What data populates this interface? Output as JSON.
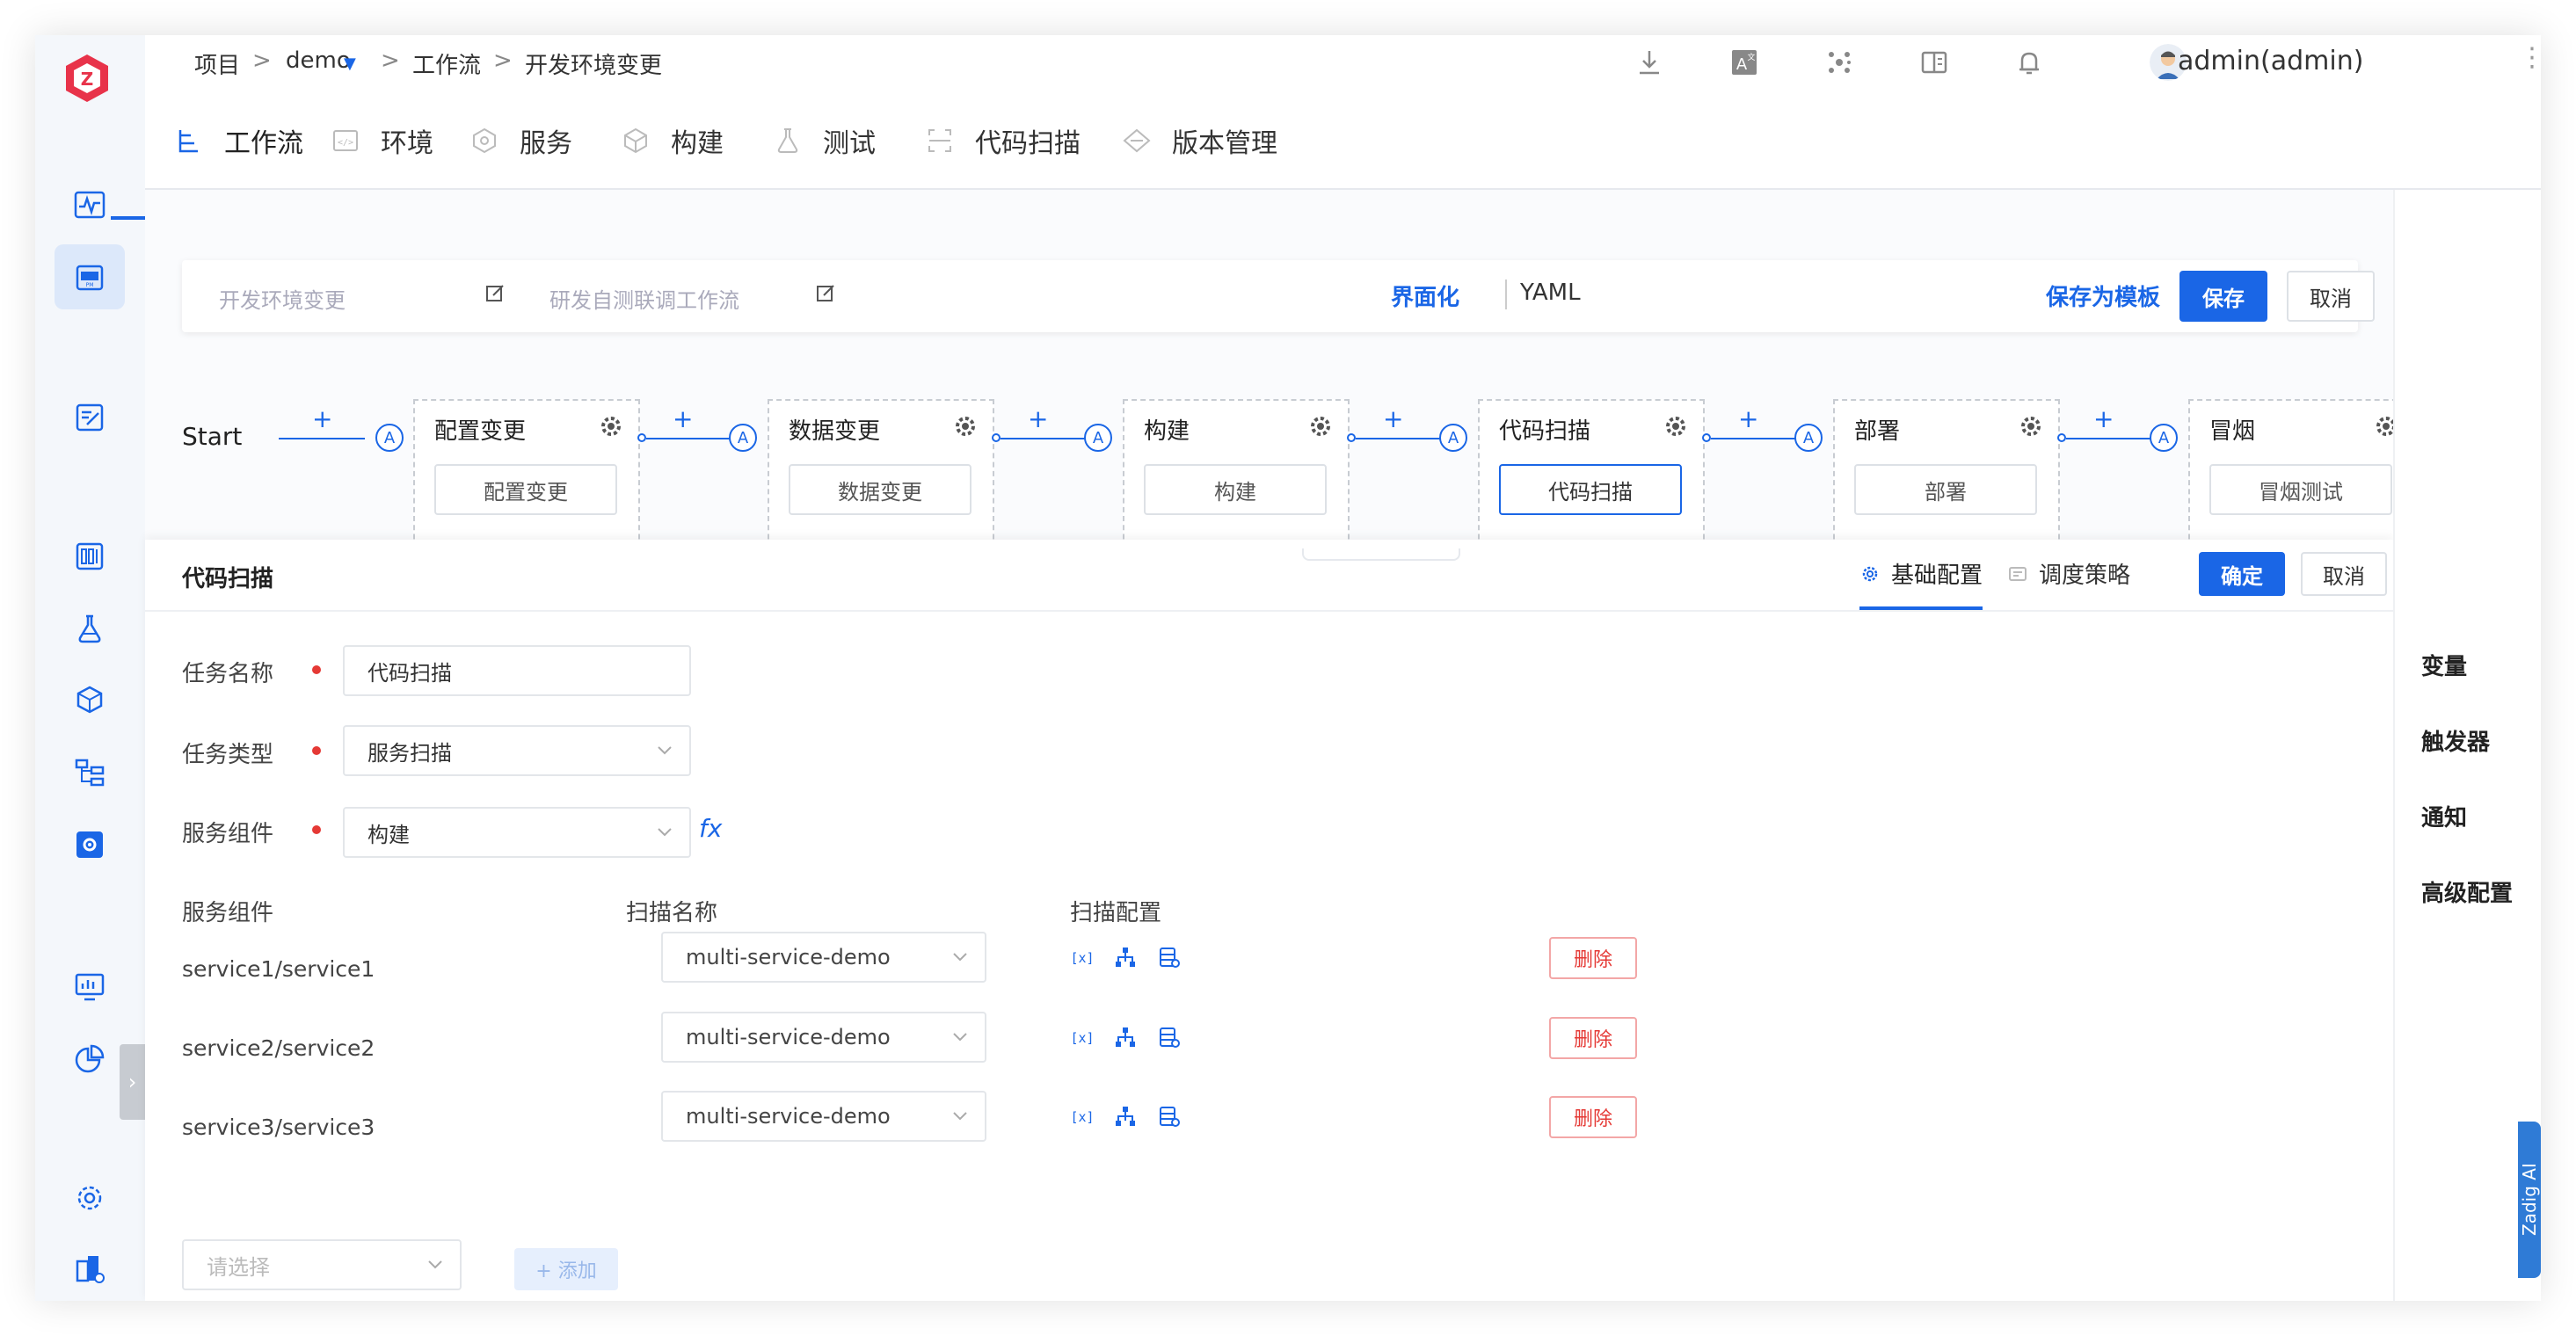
{
  "breadcrumb": {
    "project": "项目",
    "sep": ">",
    "demo": "demo",
    "workflow": "工作流",
    "current": "开发环境变更"
  },
  "user": {
    "name": "admin(admin)"
  },
  "tabs": [
    {
      "label": "工作流",
      "icon": "workflow-icon"
    },
    {
      "label": "环境",
      "icon": "environment-icon"
    },
    {
      "label": "服务",
      "icon": "service-icon"
    },
    {
      "label": "构建",
      "icon": "build-icon"
    },
    {
      "label": "测试",
      "icon": "test-icon"
    },
    {
      "label": "代码扫描",
      "icon": "code-scan-icon"
    },
    {
      "label": "版本管理",
      "icon": "version-icon"
    }
  ],
  "topcard": {
    "workflow_name": "开发环境变更",
    "workflow_desc": "研发自测联调工作流",
    "ui_mode": "界面化",
    "yaml_mode": "YAML",
    "save_template": "保存为模板",
    "save": "保存",
    "cancel": "取消"
  },
  "pipeline": {
    "start": "Start",
    "plus": "+",
    "approval": "A",
    "stages": [
      {
        "title": "配置变更",
        "job": "配置变更"
      },
      {
        "title": "数据变更",
        "job": "数据变更"
      },
      {
        "title": "构建",
        "job": "构建"
      },
      {
        "title": "代码扫描",
        "job": "代码扫描"
      },
      {
        "title": "部署",
        "job": "部署"
      },
      {
        "title": "冒烟",
        "job": "冒烟测试"
      }
    ]
  },
  "editor": {
    "title": "代码扫描",
    "tab_basic": "基础配置",
    "tab_schedule": "调度策略",
    "confirm": "确定",
    "cancel": "取消",
    "fields": {
      "task_name_label": "任务名称",
      "task_name_value": "代码扫描",
      "task_type_label": "任务类型",
      "task_type_value": "服务扫描",
      "service_comp_label": "服务组件",
      "service_comp_value": "构建",
      "fx": "fx"
    },
    "table": {
      "headers": [
        "服务组件",
        "扫描名称",
        "扫描配置"
      ],
      "rows": [
        {
          "service": "service1/service1",
          "scan": "multi-service-demo",
          "delete": "删除"
        },
        {
          "service": "service2/service2",
          "scan": "multi-service-demo",
          "delete": "删除"
        },
        {
          "service": "service3/service3",
          "scan": "multi-service-demo",
          "delete": "删除"
        }
      ]
    },
    "add_placeholder": "请选择",
    "add_button": "+ 添加"
  },
  "right_panel": [
    "变量",
    "触发器",
    "通知",
    "高级配置"
  ],
  "zadig_ai": "Zadig AI",
  "colors": {
    "accent": "#1a66e6",
    "danger": "#e53935",
    "logo": "#e8334a"
  }
}
